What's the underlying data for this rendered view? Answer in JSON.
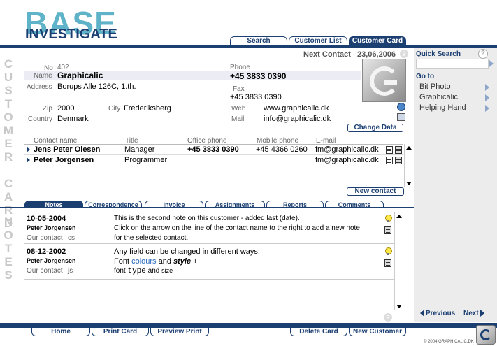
{
  "logo": {
    "top": "BASE",
    "bottom": "INVESTIGATE"
  },
  "tabs": [
    {
      "label": "Search"
    },
    {
      "label": "Customer List"
    },
    {
      "label": "Customer Card"
    }
  ],
  "side_labels": {
    "customer_card": "CUSTOMER CARD",
    "notes": "NOTES"
  },
  "customer": {
    "next_contact_label": "Next Contact",
    "next_contact_date": "23,06,2006",
    "help": "?",
    "no_label": "No",
    "no": "402",
    "name_label": "Name",
    "name": "Graphicalic",
    "address_label": "Address",
    "address": "Borups Alle 126C, 1.th.",
    "zip_label": "Zip",
    "zip": "2000",
    "city_label": "City",
    "city": "Frederiksberg",
    "country_label": "Country",
    "country": "Denmark",
    "phone_label": "Phone",
    "phone": "+45 3833 0390",
    "fax_label": "Fax",
    "fax": "+45 3833 0390",
    "web_label": "Web",
    "web": "www.graphicalic.dk",
    "mail_label": "Mail",
    "mail": "info@graphicalic.dk",
    "change_data": "Change Data"
  },
  "contacts": {
    "headers": [
      "Contact name",
      "Title",
      "Office phone",
      "Mobile phone",
      "E-mail"
    ],
    "rows": [
      {
        "name": "Jens Peter Olesen",
        "title": "Manager",
        "office": "+45 3833 0390",
        "mobile": "+45 4366 0260",
        "email": "fm@graphicalic.dk"
      },
      {
        "name": "Peter Jorgensen",
        "title": "Programmer",
        "office": "",
        "mobile": "",
        "email": "fm@graphicalic.dk"
      }
    ],
    "new_contact": "New contact"
  },
  "note_tabs": [
    "Notes",
    "Correspondence",
    "Invoice",
    "Assignments",
    "Reports",
    "Comments"
  ],
  "notes": [
    {
      "date": "10-05-2004",
      "author": "Peter Jorgensen",
      "our_contact_label": "Our contact",
      "our_contact": "cs",
      "lines": [
        "This is the second note on this customer - added last (date).",
        "Click on the arrow on the line of the contact name to the right to add a new note",
        "for the selected contact."
      ]
    },
    {
      "date": "08-12-2002",
      "author": "Peter Jorgensen",
      "our_contact_label": "Our contact",
      "our_contact": "js",
      "line1": "Any field can be changed in different ways:",
      "line2_a": "Font ",
      "line2_b": "colours",
      "line2_c": " and ",
      "line2_d": "style",
      "line2_e": " +",
      "line3_a": "font ",
      "line3_b": "type",
      "line3_c": " and ",
      "line3_d": "size"
    }
  ],
  "sidebar": {
    "quick_search": "Quick Search",
    "help": "?",
    "goto": "Go to",
    "items": [
      "Bit Photo",
      "Graphicalic",
      "Helping Hand"
    ],
    "previous": "Previous",
    "next": "Next"
  },
  "bottom_buttons": {
    "home": "Home",
    "print_card": "Print Card",
    "preview_print": "Preview Print",
    "delete_card": "Delete Card",
    "new_customer": "New Customer"
  },
  "copyright": "© 2004 GRAPHICALIC.DK"
}
